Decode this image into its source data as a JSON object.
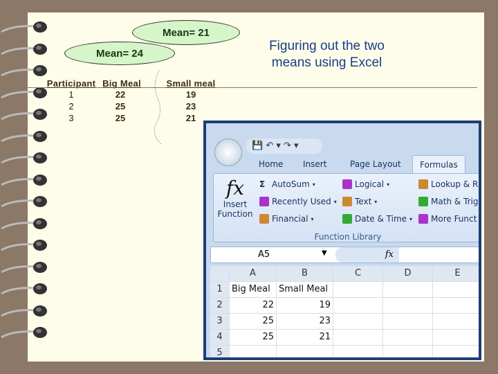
{
  "title": "Figuring out the two means using Excel",
  "bubbles": {
    "big": "Mean= 24",
    "small": "Mean= 21"
  },
  "table": {
    "headers": [
      "Participant",
      "Big Meal",
      "Small meal"
    ],
    "rows": [
      [
        "1",
        "22",
        "19"
      ],
      [
        "2",
        "25",
        "23"
      ],
      [
        "3",
        "25",
        "21"
      ]
    ]
  },
  "excel": {
    "tabs": [
      "Home",
      "Insert",
      "Page Layout",
      "Formulas"
    ],
    "active_tab": "Formulas",
    "insert_function": [
      "Insert",
      "Function"
    ],
    "items": [
      [
        "AutoSum",
        "Recently Used",
        "Financial"
      ],
      [
        "Logical",
        "Text",
        "Date & Time"
      ],
      [
        "Lookup & R",
        "Math & Trig",
        "More Funct"
      ]
    ],
    "group_label": "Function Library",
    "name_box": "A5",
    "fx": "fx",
    "columns": [
      "A",
      "B",
      "C",
      "D",
      "E"
    ],
    "rows": [
      [
        "1",
        "Big Meal",
        "Small Meal",
        "",
        "",
        ""
      ],
      [
        "2",
        "22",
        "19",
        "",
        "",
        ""
      ],
      [
        "3",
        "25",
        "23",
        "",
        "",
        ""
      ],
      [
        "4",
        "25",
        "21",
        "",
        "",
        ""
      ],
      [
        "5",
        "",
        "",
        "",
        "",
        ""
      ]
    ]
  }
}
